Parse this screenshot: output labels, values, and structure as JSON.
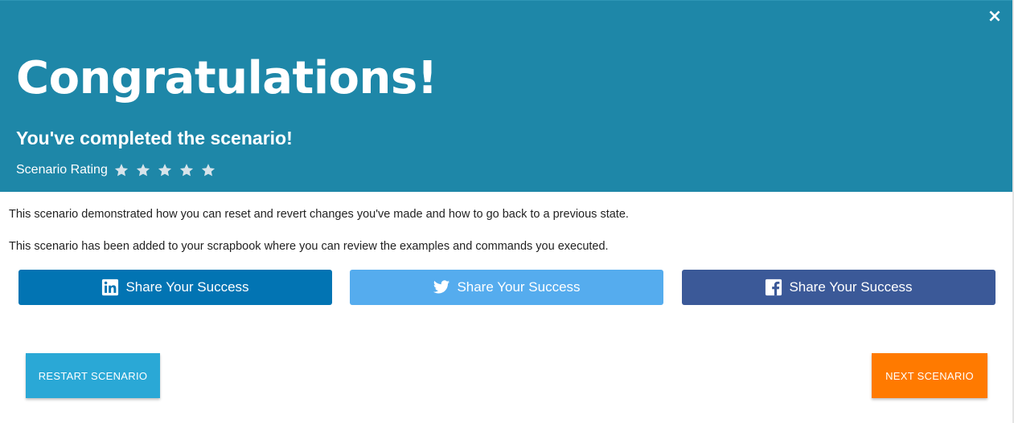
{
  "header": {
    "close_label": "×",
    "title": "Congratulations!",
    "subtitle": "You've completed the scenario!",
    "rating_label": "Scenario Rating",
    "rating_max": 5,
    "rating_value": 0,
    "star_color": "#d6e3ea",
    "background_color": "#1e87a8"
  },
  "body": {
    "line1": "This scenario demonstrated how you can reset and revert changes you've made and how to go back to a previous state.",
    "line2": "This scenario has been added to your scrapbook where you can review the examples and commands you executed."
  },
  "share": {
    "linkedin": {
      "label": "Share Your Success",
      "icon": "linkedin-icon",
      "color": "#0274b3"
    },
    "twitter": {
      "label": "Share Your Success",
      "icon": "twitter-icon",
      "color": "#55acee"
    },
    "facebook": {
      "label": "Share Your Success",
      "icon": "facebook-icon",
      "color": "#3b5998"
    }
  },
  "actions": {
    "restart_label": "RESTART SCENARIO",
    "restart_color": "#2aa8d6",
    "next_label": "NEXT SCENARIO",
    "next_color": "#ff7a00"
  }
}
